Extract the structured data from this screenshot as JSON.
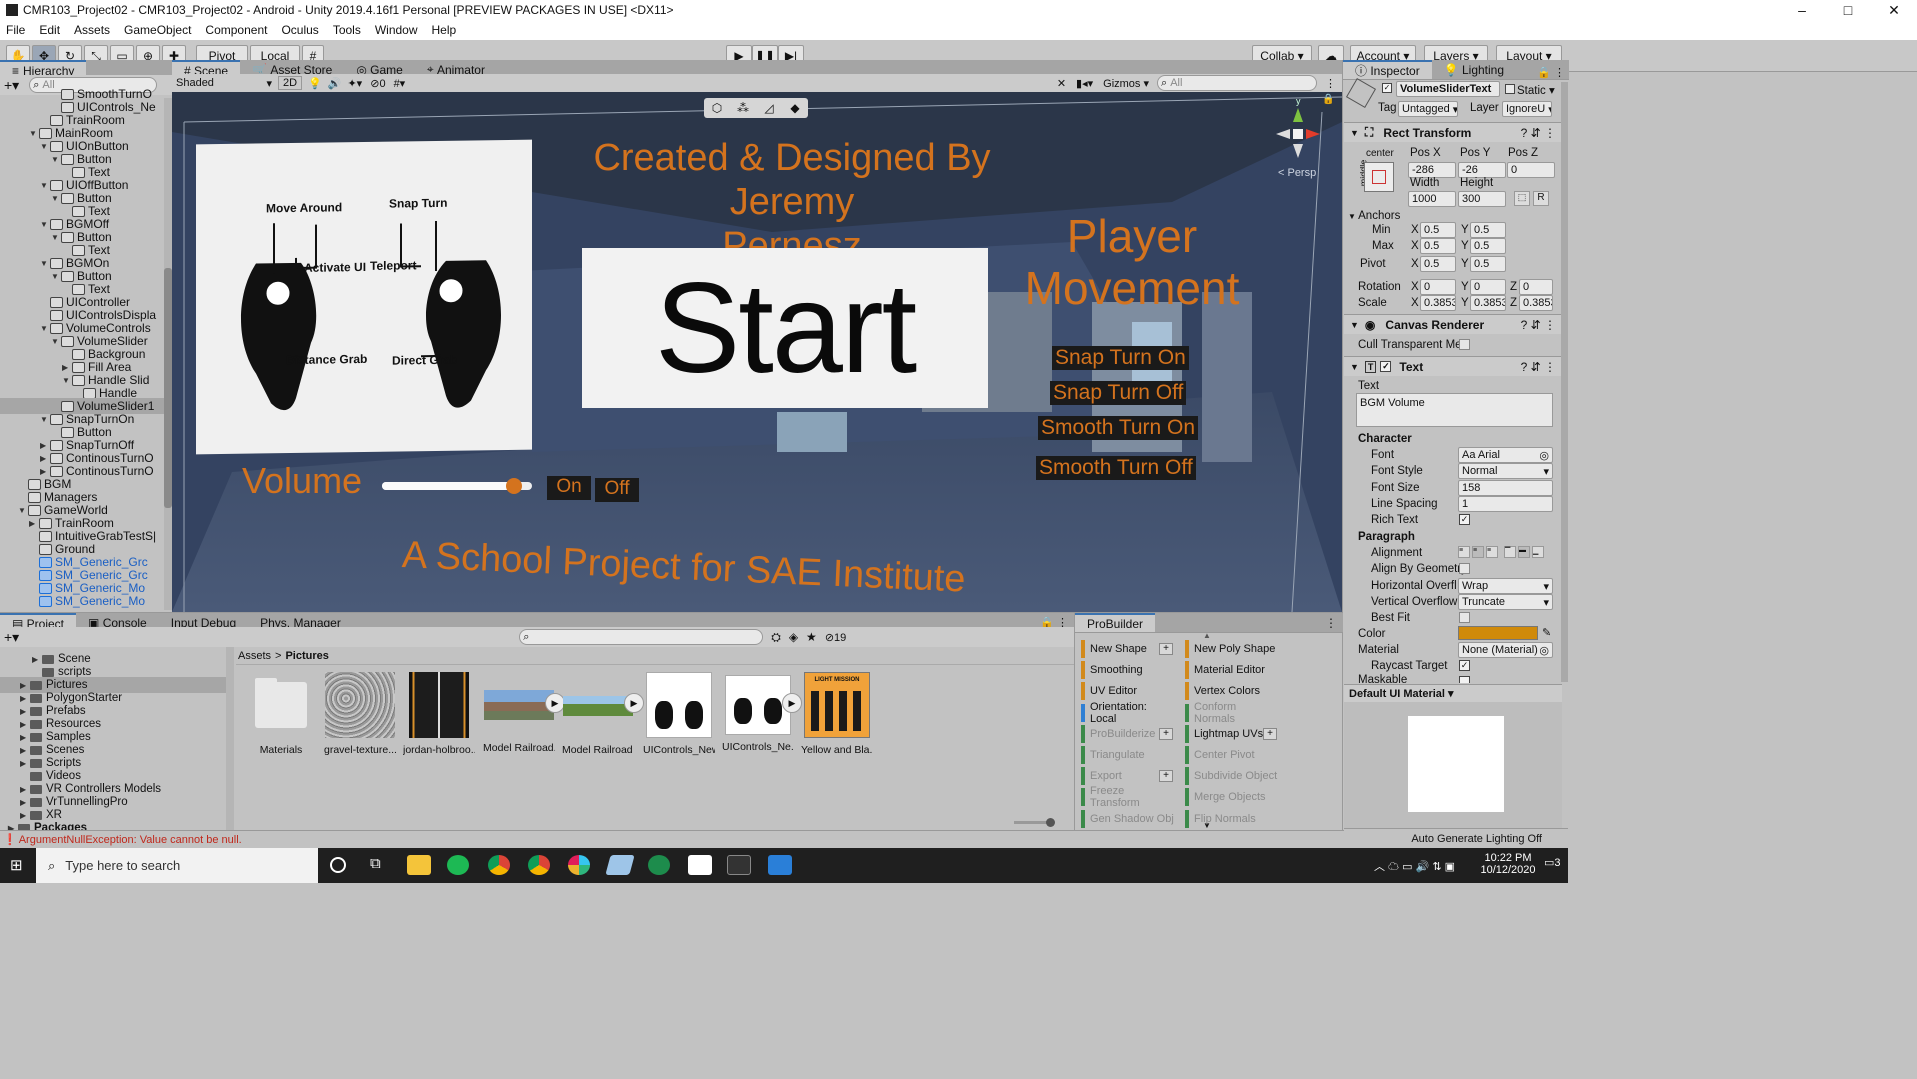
{
  "window_title": "CMR103_Project02 - CMR103_Project02 - Android - Unity 2019.4.16f1 Personal [PREVIEW PACKAGES IN USE] <DX11>",
  "window_controls": {
    "minimize": "–",
    "maximize": "□",
    "close": "✕"
  },
  "menu": [
    "File",
    "Edit",
    "Assets",
    "GameObject",
    "Component",
    "Oculus",
    "Tools",
    "Window",
    "Help"
  ],
  "toolbar": {
    "pivot": "Pivot",
    "local": "Local",
    "collab": "Collab ▾",
    "account": "Account",
    "layers": "Layers",
    "layout": "Layout"
  },
  "hierarchy": {
    "tab": "Hierarchy",
    "search_placeholder": "All",
    "items": [
      {
        "label": "SmoothTurnO",
        "indent": 5,
        "arrow": ""
      },
      {
        "label": "UIControls_Ne",
        "indent": 5,
        "arrow": ""
      },
      {
        "label": "TrainRoom",
        "indent": 4,
        "arrow": ""
      },
      {
        "label": "MainRoom",
        "indent": 3,
        "arrow": "▼"
      },
      {
        "label": "UIOnButton",
        "indent": 4,
        "arrow": "▼"
      },
      {
        "label": "Button",
        "indent": 5,
        "arrow": "▼"
      },
      {
        "label": "Text",
        "indent": 6,
        "arrow": ""
      },
      {
        "label": "UIOffButton",
        "indent": 4,
        "arrow": "▼"
      },
      {
        "label": "Button",
        "indent": 5,
        "arrow": "▼"
      },
      {
        "label": "Text",
        "indent": 6,
        "arrow": ""
      },
      {
        "label": "BGMOff",
        "indent": 4,
        "arrow": "▼"
      },
      {
        "label": "Button",
        "indent": 5,
        "arrow": "▼"
      },
      {
        "label": "Text",
        "indent": 6,
        "arrow": ""
      },
      {
        "label": "BGMOn",
        "indent": 4,
        "arrow": "▼"
      },
      {
        "label": "Button",
        "indent": 5,
        "arrow": "▼"
      },
      {
        "label": "Text",
        "indent": 6,
        "arrow": ""
      },
      {
        "label": "UIController",
        "indent": 4,
        "arrow": ""
      },
      {
        "label": "UIControlsDispla",
        "indent": 4,
        "arrow": ""
      },
      {
        "label": "VolumeControls",
        "indent": 4,
        "arrow": "▼"
      },
      {
        "label": "VolumeSlider",
        "indent": 5,
        "arrow": "▼"
      },
      {
        "label": "Backgroun",
        "indent": 6,
        "arrow": ""
      },
      {
        "label": "Fill Area",
        "indent": 6,
        "arrow": "▶"
      },
      {
        "label": "Handle Slid",
        "indent": 6,
        "arrow": "▼"
      },
      {
        "label": "Handle",
        "indent": 7,
        "arrow": ""
      },
      {
        "label": "VolumeSlider1",
        "indent": 5,
        "arrow": "",
        "selected": true
      },
      {
        "label": "SnapTurnOn",
        "indent": 4,
        "arrow": "▼"
      },
      {
        "label": "Button",
        "indent": 5,
        "arrow": ""
      },
      {
        "label": "SnapTurnOff",
        "indent": 4,
        "arrow": "▶"
      },
      {
        "label": "ContinousTurnO",
        "indent": 4,
        "arrow": "▶"
      },
      {
        "label": "ContinousTurnO",
        "indent": 4,
        "arrow": "▶"
      },
      {
        "label": "BGM",
        "indent": 2,
        "arrow": ""
      },
      {
        "label": "Managers",
        "indent": 2,
        "arrow": ""
      },
      {
        "label": "GameWorld",
        "indent": 2,
        "arrow": "▼"
      },
      {
        "label": "TrainRoom",
        "indent": 3,
        "arrow": "▶"
      },
      {
        "label": "IntuitiveGrabTestS|",
        "indent": 3,
        "arrow": ""
      },
      {
        "label": "Ground",
        "indent": 3,
        "arrow": ""
      },
      {
        "label": "SM_Generic_Grc",
        "indent": 3,
        "arrow": "",
        "blue": true
      },
      {
        "label": "SM_Generic_Grc",
        "indent": 3,
        "arrow": "",
        "blue": true
      },
      {
        "label": "SM_Generic_Mo",
        "indent": 3,
        "arrow": "",
        "blue": true
      },
      {
        "label": "SM_Generic_Mo",
        "indent": 3,
        "arrow": "",
        "blue": true
      }
    ]
  },
  "scene": {
    "tabs": [
      "Scene",
      "Asset Store",
      "Game",
      "Animator"
    ],
    "shading": "Shaded",
    "mode_2d": "2D",
    "hidden_count": "0",
    "gizmos": "Gizmos",
    "search_placeholder": "All",
    "persp": "< Persp",
    "credit_line1": "Created & Designed By Jeremy",
    "credit_line2": "Pernesz",
    "start": "Start",
    "player_movement_1": "Player",
    "player_movement_2": "Movement",
    "snap_on": "Snap Turn On",
    "snap_off": "Snap Turn Off",
    "smooth_on": "Smooth Turn On",
    "smooth_off": "Smooth Turn Off",
    "volume": "Volume",
    "volume_level": 0.88,
    "on": "On",
    "off": "Off",
    "school": "A School Project for SAE Institute",
    "controls_card": {
      "move": "Move Around",
      "snap": "Snap Turn",
      "activate": "Activate UI",
      "teleport": "Teleport",
      "distance": "Distance Grab",
      "direct": "Direct Grab"
    }
  },
  "inspector": {
    "tabs": [
      "Inspector",
      "Lighting"
    ],
    "object_name": "VolumeSliderText",
    "static": "Static ▾",
    "tag_label": "Tag",
    "tag": "Untagged",
    "layer_label": "Layer",
    "layer": "IgnoreU",
    "rect_transform": {
      "title": "Rect Transform",
      "anchor_preset": "center",
      "side": "middle",
      "posx_label": "Pos X",
      "posy_label": "Pos Y",
      "posz_label": "Pos Z",
      "posx": "-286",
      "posy": "-26",
      "posz": "0",
      "width_label": "Width",
      "height_label": "Height",
      "width": "1000",
      "height": "300",
      "r_btn": "R",
      "anchors_label": "Anchors",
      "min_label": "Min",
      "max_label": "Max",
      "pivot_label": "Pivot",
      "min_x": "0.5",
      "min_y": "0.5",
      "max_x": "0.5",
      "max_y": "0.5",
      "pivot_x": "0.5",
      "pivot_y": "0.5",
      "rotation_label": "Rotation",
      "rot_x": "0",
      "rot_y": "0",
      "rot_z": "0",
      "scale_label": "Scale",
      "scale_x": "0.3853",
      "scale_y": "0.3853",
      "scale_z": "0.3853"
    },
    "canvas_renderer": {
      "title": "Canvas Renderer",
      "cull": "Cull Transparent Mes"
    },
    "text": {
      "title": "Text",
      "text_label": "Text",
      "text_value": "BGM Volume",
      "character": "Character",
      "font_label": "Font",
      "font": "Aa Arial",
      "font_style_label": "Font Style",
      "font_style": "Normal",
      "font_size_label": "Font Size",
      "font_size": "158",
      "line_spacing_label": "Line Spacing",
      "line_spacing": "1",
      "rich_text_label": "Rich Text",
      "paragraph": "Paragraph",
      "alignment_label": "Alignment",
      "align_geom_label": "Align By Geometry",
      "hover_label": "Horizontal Overflo",
      "hover": "Wrap",
      "vover_label": "Vertical Overflow",
      "vover": "Truncate",
      "best_fit_label": "Best Fit",
      "color_label": "Color",
      "color": "#d08a0a",
      "material_label": "Material",
      "material": "None (Material)",
      "raycast_label": "Raycast Target",
      "maskable_label": "Maskable"
    },
    "default_material": "Default UI Material ▾",
    "auto_lighting": "Auto Generate Lighting Off"
  },
  "project": {
    "tabs": [
      "Project",
      "Console",
      "Input Debug",
      "Phys. Manager"
    ],
    "hidden_count": "19",
    "tree": [
      {
        "label": "Scene",
        "indent": 2,
        "arrow": "▶"
      },
      {
        "label": "scripts",
        "indent": 2,
        "arrow": ""
      },
      {
        "label": "Pictures",
        "indent": 1,
        "arrow": "▶",
        "selected": true
      },
      {
        "label": "PolygonStarter",
        "indent": 1,
        "arrow": "▶"
      },
      {
        "label": "Prefabs",
        "indent": 1,
        "arrow": "▶"
      },
      {
        "label": "Resources",
        "indent": 1,
        "arrow": "▶"
      },
      {
        "label": "Samples",
        "indent": 1,
        "arrow": "▶"
      },
      {
        "label": "Scenes",
        "indent": 1,
        "arrow": "▶"
      },
      {
        "label": "Scripts",
        "indent": 1,
        "arrow": "▶"
      },
      {
        "label": "Videos",
        "indent": 1,
        "arrow": ""
      },
      {
        "label": "VR Controllers Models",
        "indent": 1,
        "arrow": "▶"
      },
      {
        "label": "VrTunnellingPro",
        "indent": 1,
        "arrow": "▶"
      },
      {
        "label": "XR",
        "indent": 1,
        "arrow": "▶"
      },
      {
        "label": "Packages",
        "indent": 0,
        "arrow": "▶",
        "bold": true
      }
    ],
    "breadcrumb_root": "Assets",
    "breadcrumb_sep": ">",
    "breadcrumb_current": "Pictures",
    "assets": [
      "Materials",
      "gravel-texture...",
      "jordan-holbroo...",
      "Model Railroad...",
      "Model Railroad ...",
      "UIControls_New",
      "UIControls_Ne...",
      "Yellow and Bla..."
    ],
    "poster_title": "LIGHT MISSION"
  },
  "probuilder": {
    "tab": "ProBuilder",
    "left": [
      {
        "label": "New Shape",
        "plus": true,
        "color": "#d28a1c"
      },
      {
        "label": "Smoothing",
        "color": "#d28a1c"
      },
      {
        "label": "UV Editor",
        "color": "#d28a1c"
      },
      {
        "label": "Orientation: Local",
        "color": "#2e7fd4"
      },
      {
        "label": "ProBuilderize",
        "plus": true,
        "color": "#3b8a4a",
        "dim": true
      },
      {
        "label": "Triangulate",
        "color": "#3b8a4a",
        "dim": true
      },
      {
        "label": "Export",
        "plus": true,
        "color": "#3b8a4a",
        "dim": true
      },
      {
        "label": "Freeze Transform",
        "color": "#3b8a4a",
        "dim": true
      },
      {
        "label": "Gen Shadow Obj",
        "color": "#3b8a4a",
        "dim": true
      }
    ],
    "right": [
      {
        "label": "New Poly Shape",
        "color": "#d28a1c"
      },
      {
        "label": "Material Editor",
        "color": "#d28a1c"
      },
      {
        "label": "Vertex Colors",
        "color": "#d28a1c"
      },
      {
        "label": "Conform Normals",
        "color": "#3b8a4a",
        "dim": true
      },
      {
        "label": "Lightmap UVs",
        "plus": true,
        "color": "#3b8a4a"
      },
      {
        "label": "Center Pivot",
        "color": "#3b8a4a",
        "dim": true
      },
      {
        "label": "Subdivide Object",
        "color": "#3b8a4a",
        "dim": true
      },
      {
        "label": "Merge Objects",
        "color": "#3b8a4a",
        "dim": true
      },
      {
        "label": "Flip Normals",
        "color": "#3b8a4a",
        "dim": true
      }
    ]
  },
  "status": {
    "error": "ArgumentNullException: Value cannot be null."
  },
  "taskbar": {
    "search": "Type here to search",
    "time": "10:22 PM",
    "date": "10/12/2020",
    "notif": "3"
  }
}
